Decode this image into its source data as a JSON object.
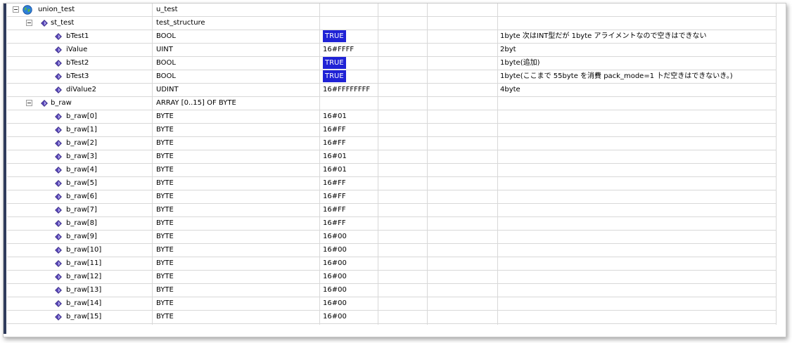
{
  "rows": [
    {
      "name": "union_test",
      "type": "u_test",
      "value": "",
      "comment": "",
      "level": 0,
      "icon": "globe-icon",
      "expander": true
    },
    {
      "name": "st_test",
      "type": "test_structure",
      "value": "",
      "comment": "",
      "level": 1,
      "icon": "variable-icon",
      "expander": true
    },
    {
      "name": "bTest1",
      "type": "BOOL",
      "value": "TRUE",
      "comment": "1byte 次はINT型だが 1byte アライメントなので空きはできない",
      "level": 2,
      "icon": "variable-icon",
      "highlight": true
    },
    {
      "name": "iValue",
      "type": "UINT",
      "value": "16#FFFF",
      "comment": "2byt",
      "level": 2,
      "icon": "variable-icon"
    },
    {
      "name": "bTest2",
      "type": "BOOL",
      "value": "TRUE",
      "comment": "1byte(追加)",
      "level": 2,
      "icon": "variable-icon",
      "highlight": true
    },
    {
      "name": "bTest3",
      "type": "BOOL",
      "value": "TRUE",
      "comment": "1byte(ここまで 55byte を消費 pack_mode=1 卜だ空きはできないき。)",
      "level": 2,
      "icon": "variable-icon",
      "highlight": true
    },
    {
      "name": "diValue2",
      "type": "UDINT",
      "value": "16#FFFFFFFF",
      "comment": "4byte",
      "level": 2,
      "icon": "variable-icon"
    },
    {
      "name": "b_raw",
      "type": "ARRAY [0..15] OF BYTE",
      "value": "",
      "comment": "",
      "level": 1,
      "icon": "variable-icon",
      "expander": true
    },
    {
      "name": "b_raw[0]",
      "type": "BYTE",
      "value": "16#01",
      "comment": "",
      "level": 2,
      "icon": "variable-icon"
    },
    {
      "name": "b_raw[1]",
      "type": "BYTE",
      "value": "16#FF",
      "comment": "",
      "level": 2,
      "icon": "variable-icon"
    },
    {
      "name": "b_raw[2]",
      "type": "BYTE",
      "value": "16#FF",
      "comment": "",
      "level": 2,
      "icon": "variable-icon"
    },
    {
      "name": "b_raw[3]",
      "type": "BYTE",
      "value": "16#01",
      "comment": "",
      "level": 2,
      "icon": "variable-icon"
    },
    {
      "name": "b_raw[4]",
      "type": "BYTE",
      "value": "16#01",
      "comment": "",
      "level": 2,
      "icon": "variable-icon"
    },
    {
      "name": "b_raw[5]",
      "type": "BYTE",
      "value": "16#FF",
      "comment": "",
      "level": 2,
      "icon": "variable-icon"
    },
    {
      "name": "b_raw[6]",
      "type": "BYTE",
      "value": "16#FF",
      "comment": "",
      "level": 2,
      "icon": "variable-icon"
    },
    {
      "name": "b_raw[7]",
      "type": "BYTE",
      "value": "16#FF",
      "comment": "",
      "level": 2,
      "icon": "variable-icon"
    },
    {
      "name": "b_raw[8]",
      "type": "BYTE",
      "value": "16#FF",
      "comment": "",
      "level": 2,
      "icon": "variable-icon"
    },
    {
      "name": "b_raw[9]",
      "type": "BYTE",
      "value": "16#00",
      "comment": "",
      "level": 2,
      "icon": "variable-icon"
    },
    {
      "name": "b_raw[10]",
      "type": "BYTE",
      "value": "16#00",
      "comment": "",
      "level": 2,
      "icon": "variable-icon"
    },
    {
      "name": "b_raw[11]",
      "type": "BYTE",
      "value": "16#00",
      "comment": "",
      "level": 2,
      "icon": "variable-icon"
    },
    {
      "name": "b_raw[12]",
      "type": "BYTE",
      "value": "16#00",
      "comment": "",
      "level": 2,
      "icon": "variable-icon"
    },
    {
      "name": "b_raw[13]",
      "type": "BYTE",
      "value": "16#00",
      "comment": "",
      "level": 2,
      "icon": "variable-icon"
    },
    {
      "name": "b_raw[14]",
      "type": "BYTE",
      "value": "16#00",
      "comment": "",
      "level": 2,
      "icon": "variable-icon"
    },
    {
      "name": "b_raw[15]",
      "type": "BYTE",
      "value": "16#00",
      "comment": "",
      "level": 2,
      "icon": "variable-icon"
    }
  ],
  "colors": {
    "true_highlight": "#1f22d6",
    "grid_line": "#d8d8d8",
    "variable_icon": "#5a48b8",
    "left_bar": "#2f3b5c"
  }
}
